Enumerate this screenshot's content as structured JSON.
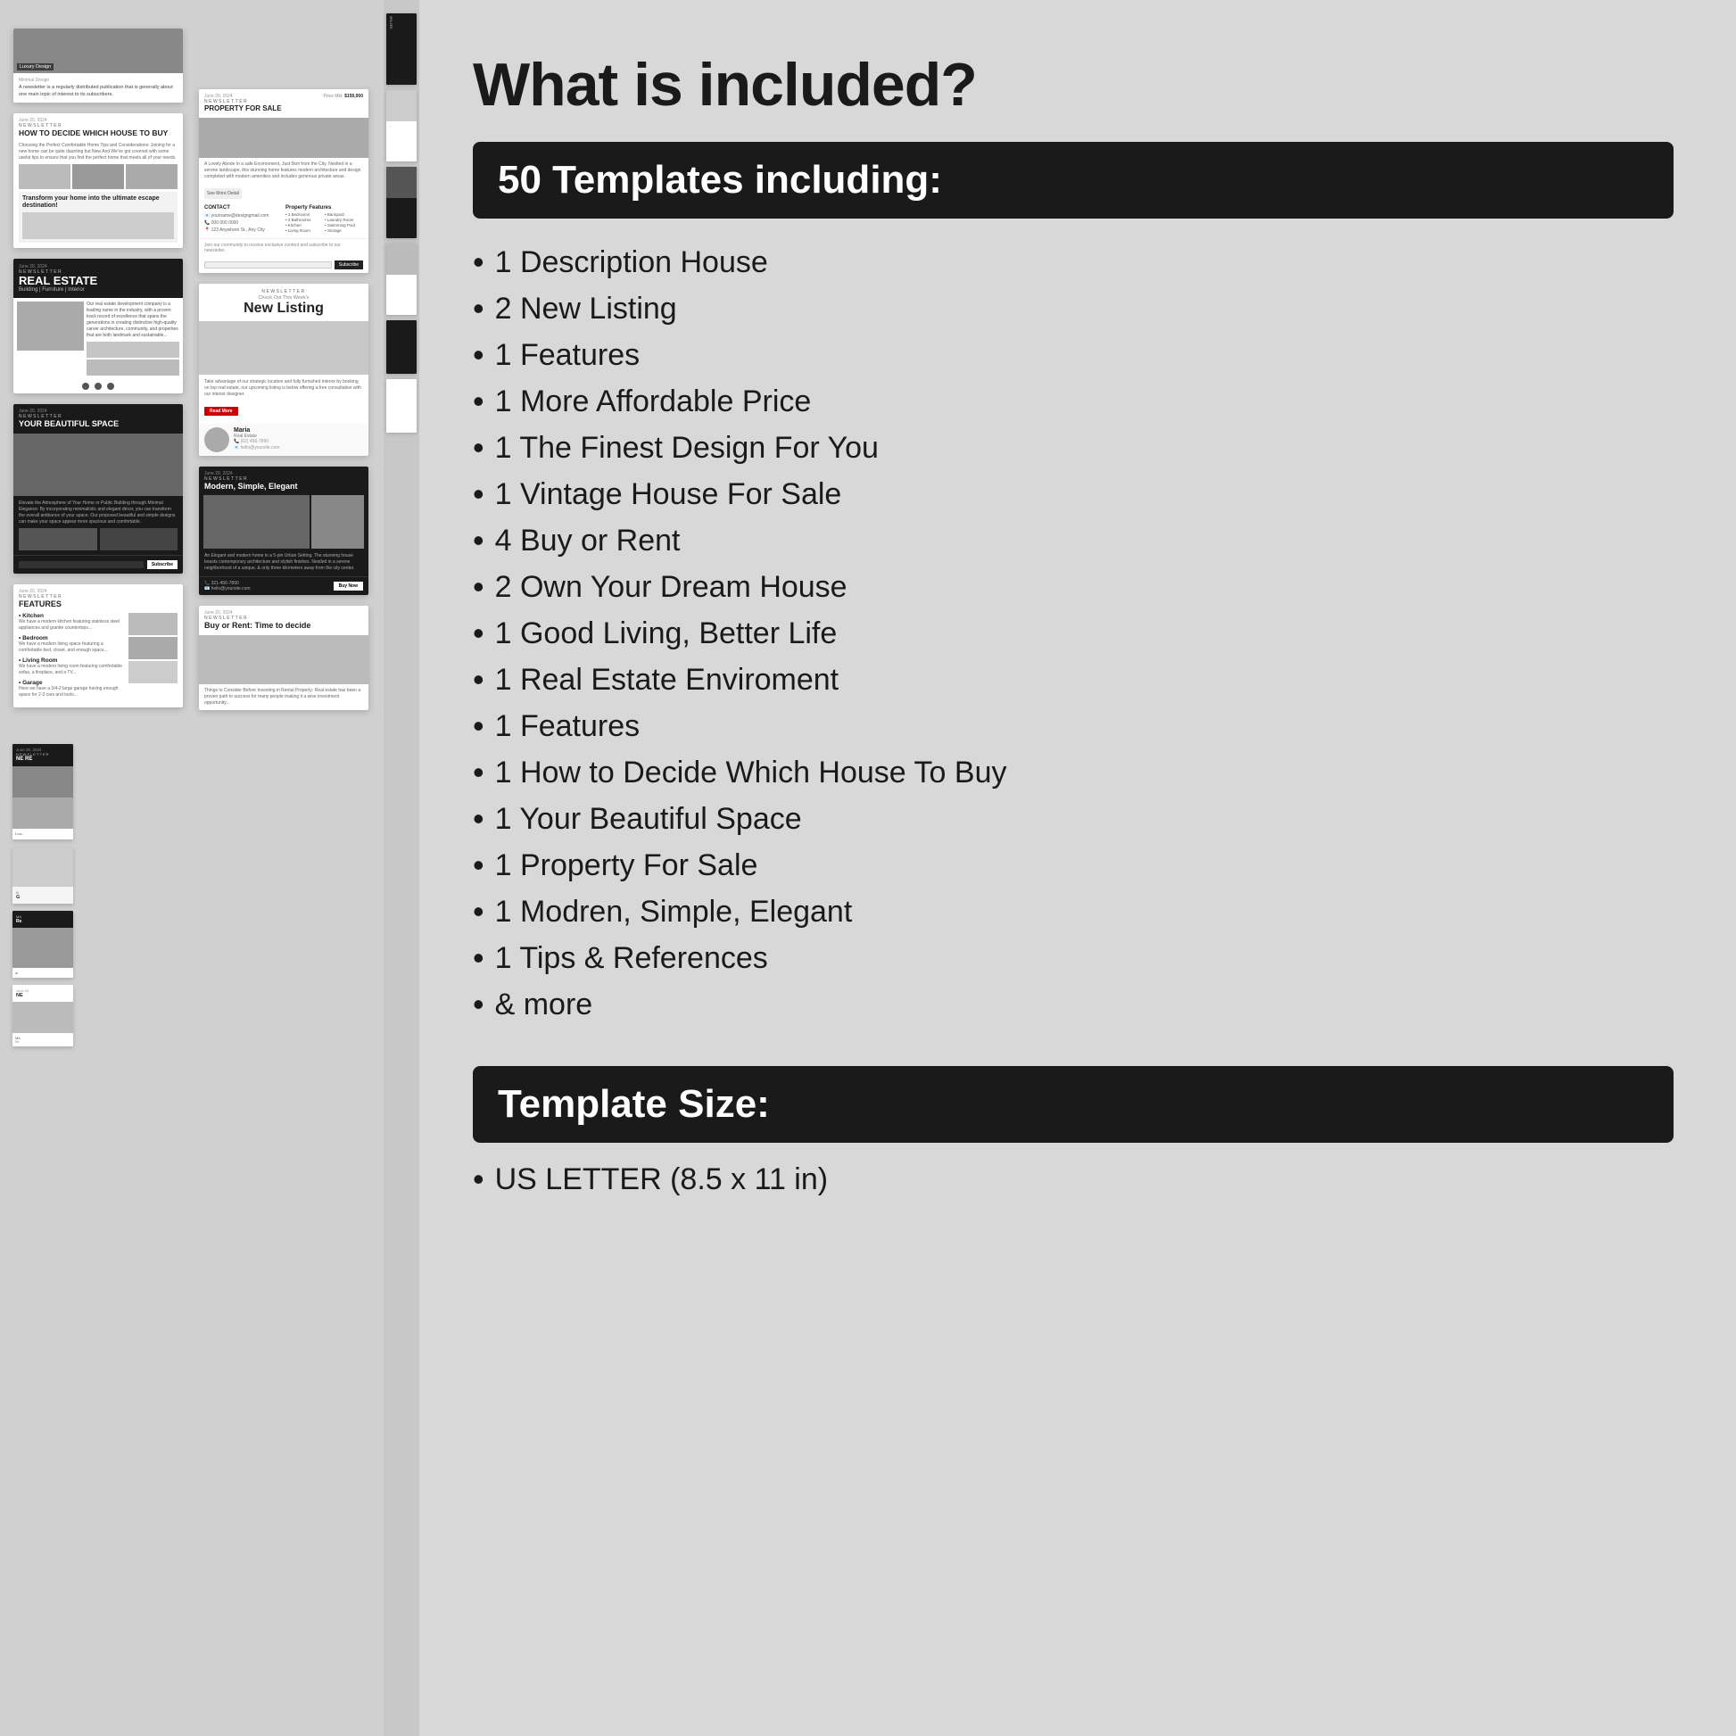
{
  "page": {
    "heading": "What is included?",
    "section1_banner": "50 Templates including:",
    "section2_banner": "Template Size:",
    "bullet_items": [
      "1 Description House",
      "2 New Listing",
      "1 Features",
      "1 More Affordable Price",
      "1 The Finest Design For You",
      "1 Vintage House For Sale",
      "4 Buy or Rent",
      "2 Own Your Dream House",
      "1 Good Living, Better Life",
      "1 Real Estate Enviroment",
      "1 Features",
      "1 How to Decide Which House To Buy",
      "1 Your Beautiful Space",
      "1 Property For Sale",
      "1 Modren, Simple, Elegant",
      "1 Tips & References",
      "& more"
    ],
    "size_items": [
      "US LETTER (8.5 x 11 in)"
    ]
  },
  "templates": {
    "card1": {
      "label": "Luxury Design",
      "description": "A newsletter is a regularly distributed publication that is generally about one main topic of interest to its subscribers."
    },
    "card2": {
      "date": "June 20, 2024",
      "nl": "NEWSLETTER",
      "title": "HOW TO DECIDE WHICH HOUSE TO BUY",
      "transform_title": "Transform your home into the ultimate escape destination!"
    },
    "card3": {
      "date": "June 20, 2024",
      "nl": "NEWSLETTER",
      "title": "REAL ESTATE",
      "subtitle": "Building | Furniture | Interior"
    },
    "card4": {
      "date": "June 20, 2024",
      "nl": "NEWSLETTER",
      "title": "YOUR BEAUTIFUL SPACE"
    },
    "card5": {
      "date": "June 20, 2024",
      "nl": "NEWSLETTER",
      "title": "FEATURES",
      "sections": [
        "Kitchen",
        "Bedroom",
        "Living Room",
        "Garage"
      ]
    },
    "card6": {
      "date": "June 20, 2024",
      "nl": "NEWSLETTER",
      "title": "PROPERTY FOR SALE",
      "contact_title": "CONTACT",
      "features_title": "Property Features",
      "price": "$150,000"
    },
    "card7": {
      "nl": "NEWSLETTER",
      "subtitle": "Check Out This Week's",
      "title": "New Listing",
      "person_name": "Maria",
      "person_role": "Real Estate"
    },
    "card8": {
      "date": "June 20, 2024",
      "nl": "NEWSLETTER",
      "title": "Modern, Simple, Elegant"
    },
    "card9": {
      "nl": "NEWSLETTER",
      "title": "Buy or Rent: Time to Decide"
    },
    "card10": {
      "date": "June 20, 2024",
      "nl": "NEWSLETTER",
      "title": "Buy or Rent: Time to decide"
    }
  }
}
